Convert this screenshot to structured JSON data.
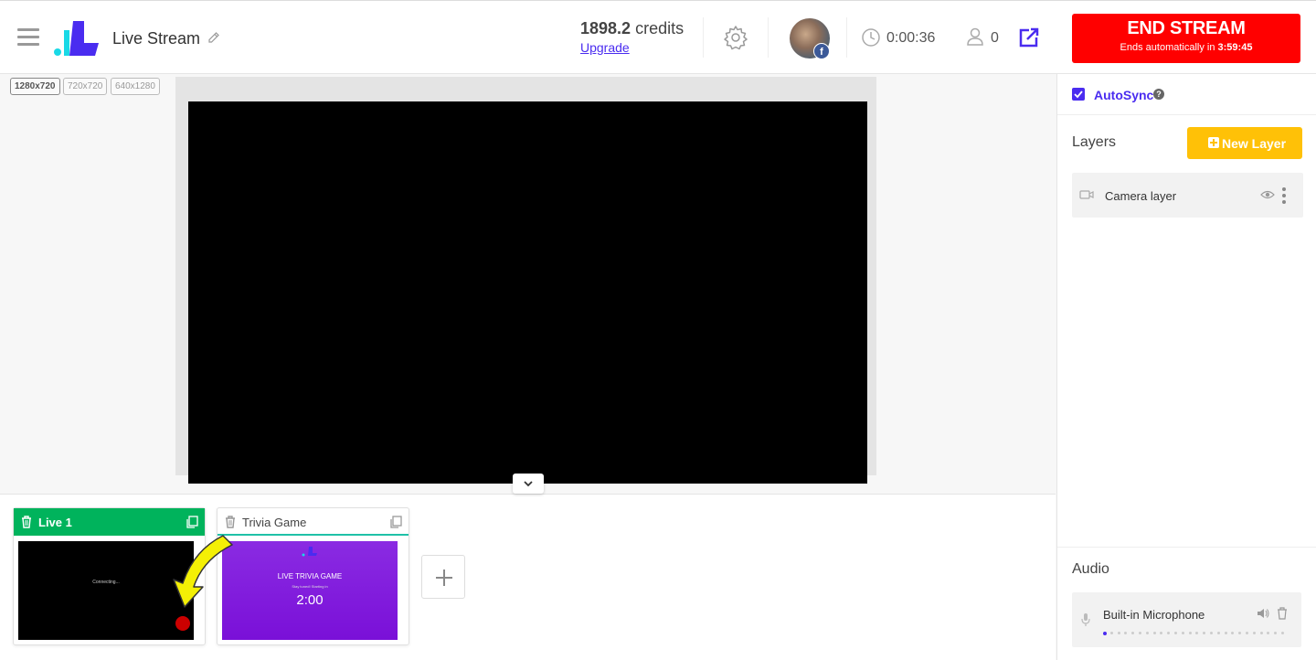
{
  "header": {
    "title": "Live Stream",
    "credits_value": "1898.2",
    "credits_unit": "credits",
    "upgrade_label": "Upgrade",
    "timer": "0:00:36",
    "viewer_count": "0",
    "fb_badge": "f",
    "end_stream": {
      "label": "END STREAM",
      "sub_prefix": "Ends automatically in ",
      "sub_time": "3:59:45"
    }
  },
  "resolutions": [
    "1280x720",
    "720x720",
    "640x1280"
  ],
  "active_resolution": "1280x720",
  "scenes": [
    {
      "name": "Live 1",
      "active": true,
      "thumb_text": "Connecting..."
    },
    {
      "name": "Trivia Game",
      "active": false,
      "thumb_title": "LIVE TRIVIA GAME",
      "thumb_sub": "Stay tuned! Starting in",
      "thumb_countdown": "2:00"
    }
  ],
  "right_panel": {
    "autosync_label": "AutoSync",
    "autosync_checked": true,
    "help": "?",
    "layers_title": "Layers",
    "new_layer_label": "New Layer",
    "layers": [
      {
        "name": "Camera layer",
        "icon": "video-camera-icon"
      }
    ],
    "audio_title": "Audio",
    "audio_sources": [
      {
        "name": "Built-in Microphone",
        "icon": "microphone-icon",
        "level": 0.04
      }
    ]
  },
  "colors": {
    "accent": "#4a2cf0",
    "end_stream": "#ff0000",
    "active_scene": "#00b35c",
    "new_layer": "#ffc107",
    "trivia_bg": "#8a2be2"
  },
  "icons": [
    "hamburger-icon",
    "pencil-icon",
    "gear-icon",
    "clock-icon",
    "user-icon",
    "external-link-icon",
    "trash-icon",
    "copy-icon",
    "chevron-down-icon",
    "plus-icon",
    "eye-icon",
    "kebab-menu-icon",
    "speaker-icon"
  ]
}
